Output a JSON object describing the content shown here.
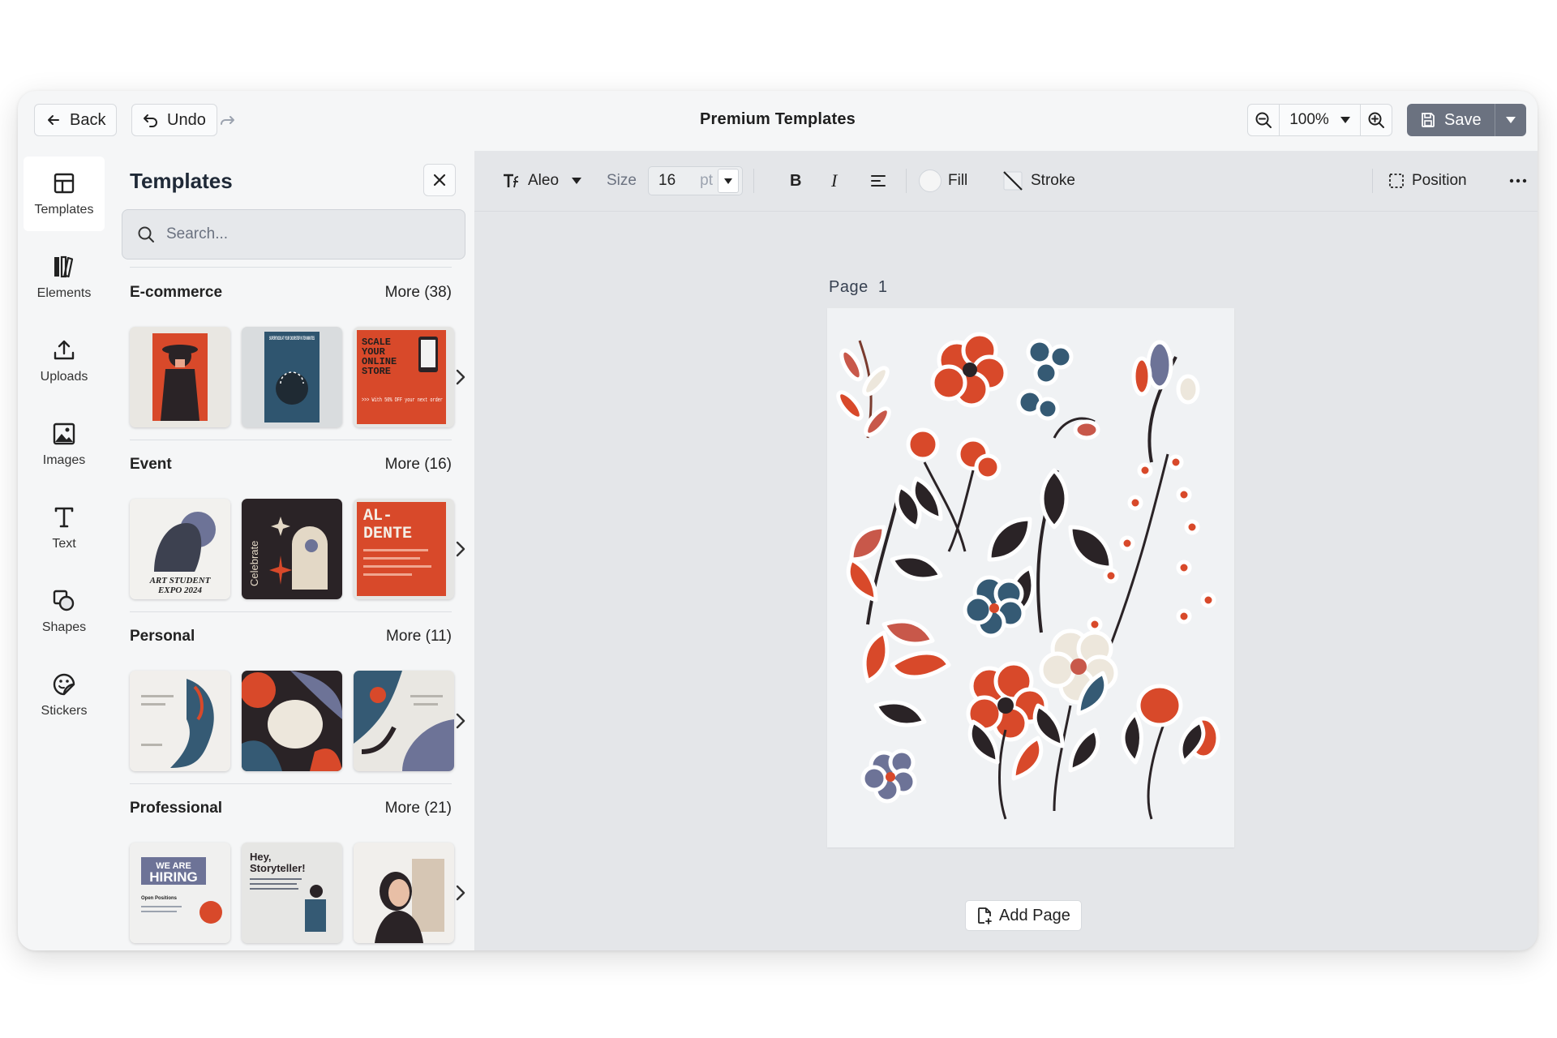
{
  "topbar": {
    "back_label": "Back",
    "undo_label": "Undo",
    "title": "Premium Templates",
    "zoom": "100%",
    "save_label": "Save"
  },
  "rail": {
    "items": [
      {
        "label": "Templates",
        "icon": "layout-icon"
      },
      {
        "label": "Elements",
        "icon": "library-icon"
      },
      {
        "label": "Uploads",
        "icon": "upload-icon"
      },
      {
        "label": "Images",
        "icon": "image-icon"
      },
      {
        "label": "Text",
        "icon": "text-icon"
      },
      {
        "label": "Shapes",
        "icon": "shapes-icon"
      },
      {
        "label": "Stickers",
        "icon": "sticker-icon"
      }
    ]
  },
  "panel": {
    "title": "Templates",
    "search_placeholder": "Search...",
    "categories": [
      {
        "name": "E-commerce",
        "more": "More (38)"
      },
      {
        "name": "Event",
        "more": "More (16)"
      },
      {
        "name": "Personal",
        "more": "More (11)"
      },
      {
        "name": "Professional",
        "more": "More (21)"
      }
    ],
    "thumb_texts": {
      "superfoods": "SUPERFOODS AT YOUR DOORSTEP IN TEN MINUTES",
      "scale": [
        "SCALE",
        "YOUR",
        "ONLINE",
        "STORE"
      ],
      "scale_sub": ">>> With 50% OFF your next order",
      "art_student": [
        "ART STUDENT",
        "EXPO 2024"
      ],
      "celebrate": "Celebrate",
      "aldente": [
        "AL-",
        "DENTE"
      ],
      "hiring": [
        "WE ARE",
        "HIRING"
      ],
      "hiring_sub": "Open Positions",
      "storyteller": [
        "Hey,",
        "Storyteller!"
      ]
    }
  },
  "toolbar": {
    "font": "Aleo",
    "size_label": "Size",
    "size_value": "16",
    "size_unit": "pt",
    "bold": "B",
    "italic": "I",
    "fill_label": "Fill",
    "stroke_label": "Stroke",
    "position_label": "Position"
  },
  "canvas": {
    "page_label": "Page  1",
    "add_page_label": "Add Page"
  },
  "colors": {
    "accent_orange": "#d8492a",
    "navy": "#355a74",
    "dark": "#2a2326",
    "cream": "#ede7dc",
    "save_bg": "#6b7280"
  }
}
